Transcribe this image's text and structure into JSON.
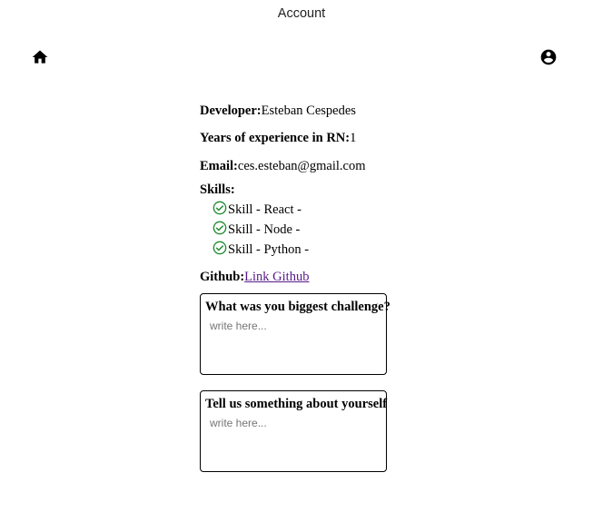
{
  "header": {
    "title": "Account"
  },
  "nav": {
    "home_icon": "home-icon",
    "profile_icon": "account-circle-icon"
  },
  "profile": {
    "developer_label": "Developer:",
    "developer_value": "Esteban Cespedes",
    "experience_label": "Years of experience in RN:",
    "experience_value": "1",
    "email_label": "Email:",
    "email_value": "ces.esteban@gmail.com",
    "skills_label": "Skills:",
    "skills": [
      {
        "text": "Skill - React -",
        "icon": "check-circle-icon"
      },
      {
        "text": "Skill - Node -",
        "icon": "check-circle-icon"
      },
      {
        "text": "Skill - Python -",
        "icon": "check-circle-icon"
      }
    ],
    "github_label": "Github:",
    "github_link_text": "Link Github"
  },
  "questions": [
    {
      "title": "What was you biggest challenge?",
      "placeholder": "write here..."
    },
    {
      "title": "Tell us something about yourself",
      "placeholder": "write here..."
    }
  ],
  "colors": {
    "check": "#1e8a2e",
    "link": "#551a8b"
  }
}
